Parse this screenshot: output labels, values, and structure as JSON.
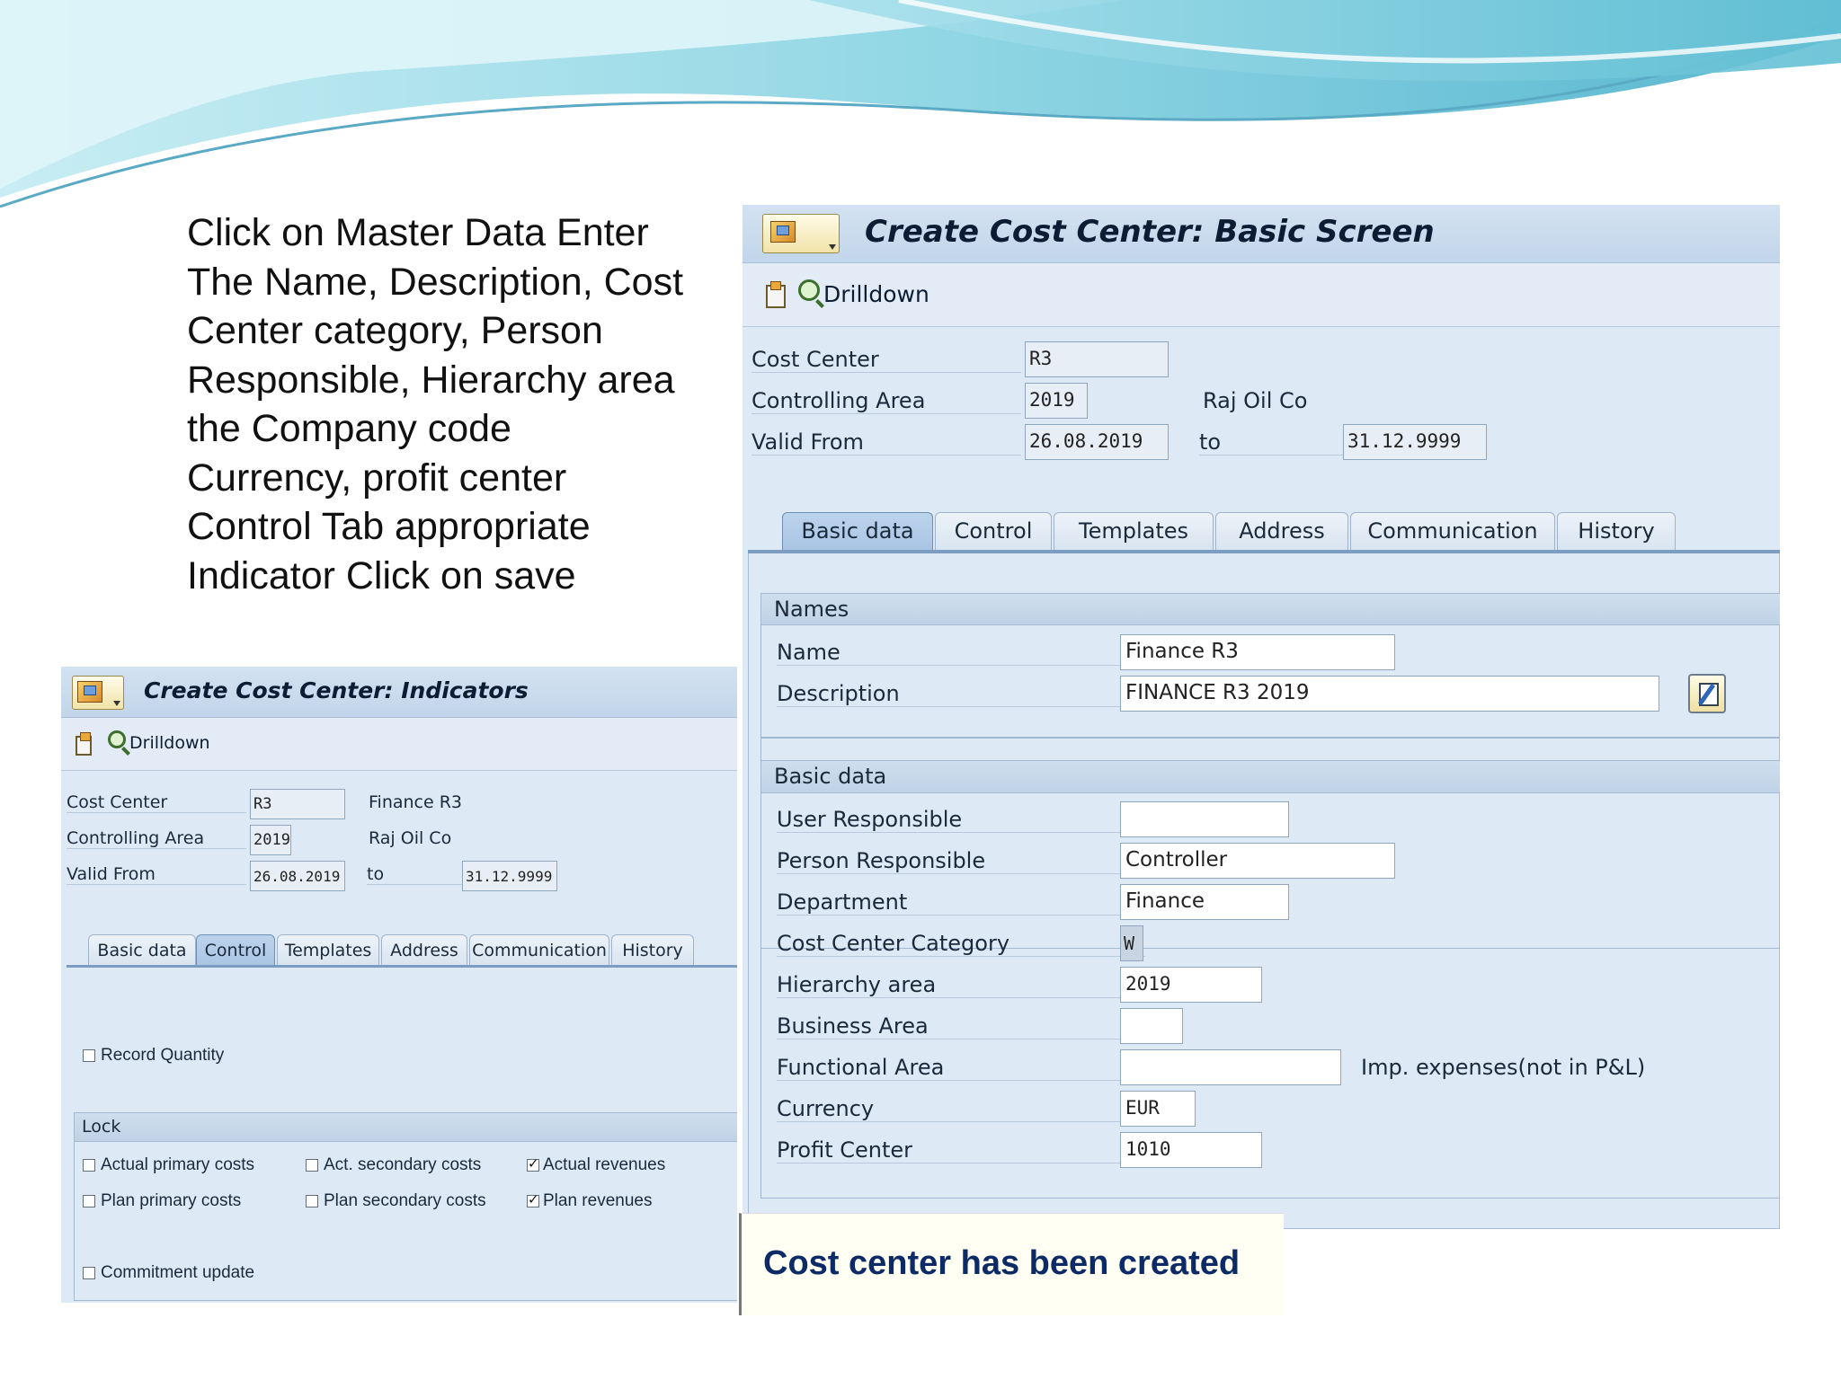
{
  "instructions": {
    "lines": [
      "Click on Master Data Enter",
      "The Name, Description, Cost",
      "Center category, Person",
      "Responsible, Hierarchy area",
      "the Company code",
      "Currency, profit center",
      "Control Tab appropriate",
      "Indicator Click on save"
    ]
  },
  "basic_screen": {
    "title": "Create Cost Center: Basic Screen",
    "drilldown_label": "Drilldown",
    "header": {
      "cost_center_label": "Cost Center",
      "cost_center_value": "R3",
      "controlling_area_label": "Controlling Area",
      "controlling_area_value": "2019",
      "controlling_area_name": "Raj Oil Co",
      "valid_from_label": "Valid From",
      "valid_from_value": "26.08.2019",
      "to_label": "to",
      "valid_to_value": "31.12.9999"
    },
    "tabs": [
      "Basic data",
      "Control",
      "Templates",
      "Address",
      "Communication",
      "History"
    ],
    "active_tab": "Basic data",
    "names_group": {
      "title": "Names",
      "name_label": "Name",
      "name_value": "Finance R3",
      "description_label": "Description",
      "description_value": "FINANCE R3 2019"
    },
    "basic_group": {
      "title": "Basic data",
      "user_responsible_label": "User Responsible",
      "user_responsible_value": "",
      "person_responsible_label": "Person Responsible",
      "person_responsible_value": "Controller",
      "department_label": "Department",
      "department_value": "Finance",
      "category_label": "Cost Center Category",
      "category_value": "W",
      "hierarchy_label": "Hierarchy area",
      "hierarchy_value": "2019",
      "business_area_label": "Business Area",
      "business_area_value": "",
      "functional_area_label": "Functional Area",
      "functional_area_value": "",
      "functional_area_desc": "Imp. expenses(not in P&L)",
      "currency_label": "Currency",
      "currency_value": "EUR",
      "profit_center_label": "Profit Center",
      "profit_center_value": "1010"
    }
  },
  "indicators_screen": {
    "title": "Create Cost Center: Indicators",
    "drilldown_label": "Drilldown",
    "header": {
      "cost_center_label": "Cost Center",
      "cost_center_value": "R3",
      "cost_center_name": "Finance R3",
      "controlling_area_label": "Controlling Area",
      "controlling_area_value": "2019",
      "controlling_area_name": "Raj Oil Co",
      "valid_from_label": "Valid From",
      "valid_from_value": "26.08.2019",
      "to_label": "to",
      "valid_to_value": "31.12.9999"
    },
    "tabs": [
      "Basic data",
      "Control",
      "Templates",
      "Address",
      "Communication",
      "History"
    ],
    "active_tab": "Control",
    "record_quantity_label": "Record Quantity",
    "lock_title": "Lock",
    "checkboxes": {
      "actual_primary": {
        "label": "Actual primary costs",
        "checked": false
      },
      "act_secondary": {
        "label": "Act. secondary costs",
        "checked": false
      },
      "actual_revenues": {
        "label": "Actual revenues",
        "checked": true
      },
      "plan_primary": {
        "label": "Plan primary costs",
        "checked": false
      },
      "plan_secondary": {
        "label": "Plan secondary costs",
        "checked": false
      },
      "plan_revenues": {
        "label": "Plan revenues",
        "checked": true
      },
      "commitment_update": {
        "label": "Commitment update",
        "checked": false
      }
    }
  },
  "status_message": "Cost center has been created",
  "colors": {
    "sap_background": "#dde9f5",
    "title_text": "#0b1d33",
    "message_text": "#0c2a66",
    "banner_teal": "#5fc6d6"
  },
  "icons": [
    "app-menu-icon",
    "other-cost-center-icon",
    "drilldown-icon",
    "edit-description-icon",
    "checkbox-icon"
  ]
}
